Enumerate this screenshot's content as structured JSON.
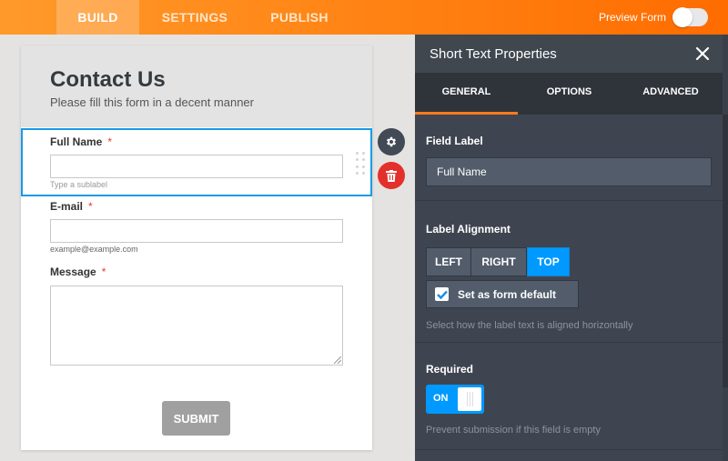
{
  "topbar": {
    "tabs": [
      {
        "label": "BUILD",
        "active": true
      },
      {
        "label": "SETTINGS",
        "active": false
      },
      {
        "label": "PUBLISH",
        "active": false
      }
    ],
    "preview_label": "Preview Form",
    "preview_on": false
  },
  "form": {
    "title": "Contact Us",
    "subtitle": "Please fill this form in a decent manner",
    "fields": [
      {
        "label": "Full Name",
        "required_mark": "*",
        "value": "",
        "sublabel": "Type a sublabel",
        "selected": true
      },
      {
        "label": "E-mail",
        "required_mark": "*",
        "value": "",
        "sublabel": "example@example.com"
      },
      {
        "label": "Message",
        "required_mark": "*",
        "value": ""
      }
    ],
    "submit_label": "SUBMIT",
    "tools": {
      "settings_icon": "gear-icon",
      "delete_icon": "trash-icon"
    }
  },
  "panel": {
    "title": "Short Text Properties",
    "close_icon": "close-icon",
    "tabs": [
      {
        "label": "GENERAL",
        "active": true
      },
      {
        "label": "OPTIONS",
        "active": false
      },
      {
        "label": "ADVANCED",
        "active": false
      }
    ],
    "field_label": {
      "title": "Field Label",
      "value": "Full Name"
    },
    "label_alignment": {
      "title": "Label Alignment",
      "options": [
        "LEFT",
        "RIGHT",
        "TOP"
      ],
      "selected": "TOP",
      "default_checkbox_label": "Set as form default",
      "default_checked": true,
      "hint": "Select how the label text is aligned horizontally"
    },
    "required": {
      "title": "Required",
      "toggle_label": "ON",
      "on": true,
      "hint": "Prevent submission if this field is empty"
    }
  },
  "colors": {
    "accent_orange": "#ff7f10",
    "selection_blue": "#1a9be6",
    "toggle_blue": "#0099ff",
    "delete_red": "#e3302a",
    "panel_bg": "#3f4550"
  }
}
